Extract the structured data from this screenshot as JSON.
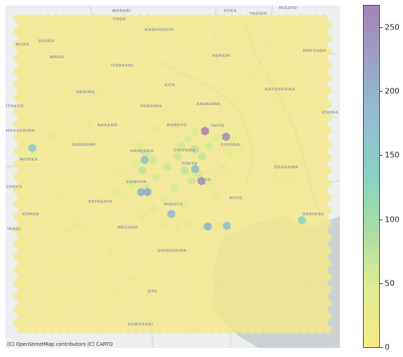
{
  "map": {
    "attribution": "(C) OpenStreetMap contributors (C) CARTO",
    "place_labels": [
      {
        "id": "warabi",
        "text": "WARABI"
      },
      {
        "id": "toda",
        "text": "TODA"
      },
      {
        "id": "soka",
        "text": "SOKA"
      },
      {
        "id": "yashio",
        "text": "YASHIO"
      },
      {
        "id": "misato",
        "text": "MISATO"
      },
      {
        "id": "kawaguchi",
        "text": "KAWAGUCHI"
      },
      {
        "id": "niiza",
        "text": "NIIZA"
      },
      {
        "id": "asaka",
        "text": "ASAKA"
      },
      {
        "id": "wako",
        "text": "WAKO"
      },
      {
        "id": "adachi",
        "text": "ADACHI"
      },
      {
        "id": "matsudo",
        "text": "MATSUDO"
      },
      {
        "id": "itabashi",
        "text": "ITABASHI"
      },
      {
        "id": "kita",
        "text": "KITA"
      },
      {
        "id": "katsushika",
        "text": "KATSUSHIKA"
      },
      {
        "id": "nerima",
        "text": "NERIMA"
      },
      {
        "id": "higashikurume",
        "text": "RTOKYO"
      },
      {
        "id": "toshima",
        "text": "TOSHIMA"
      },
      {
        "id": "arakawa",
        "text": "ARAKAWA"
      },
      {
        "id": "ichikawa",
        "text": "ICHIKA"
      },
      {
        "id": "musashino",
        "text": "MUSASHINO"
      },
      {
        "id": "nakano",
        "text": "NAKANO"
      },
      {
        "id": "bunkyo",
        "text": "BUNKYO"
      },
      {
        "id": "taito",
        "text": "TAITO"
      },
      {
        "id": "suginami",
        "text": "SUGINAMI"
      },
      {
        "id": "sumida",
        "text": "SUMIDA"
      },
      {
        "id": "shinjuku",
        "text": "SHINJUKU"
      },
      {
        "id": "chiyoda",
        "text": "CHIYODA"
      },
      {
        "id": "mitaka",
        "text": "MITAKA"
      },
      {
        "id": "tokyo",
        "text": "TOKYO"
      },
      {
        "id": "edogawa",
        "text": "EDOGAWA"
      },
      {
        "id": "chofu",
        "text": "CHOFU"
      },
      {
        "id": "shibuya",
        "text": "SHIBUYA"
      },
      {
        "id": "chuo",
        "text": "CHUO"
      },
      {
        "id": "setagaya",
        "text": "SETAGAYA"
      },
      {
        "id": "koto",
        "text": "KOTO"
      },
      {
        "id": "urayasu",
        "text": "URAYASU"
      },
      {
        "id": "minato",
        "text": "MINATO"
      },
      {
        "id": "komae",
        "text": "KOMAE"
      },
      {
        "id": "meguro",
        "text": "MEGURO"
      },
      {
        "id": "inagi",
        "text": "INAGI"
      },
      {
        "id": "shinagawa",
        "text": "SHINAGAWA"
      },
      {
        "id": "ota",
        "text": "OTA"
      },
      {
        "id": "kawasaki",
        "text": "KAWASAKI"
      }
    ]
  },
  "colorbar": {
    "ticks": [
      "0",
      "50",
      "100",
      "150",
      "200",
      "250"
    ],
    "tick_values": [
      0,
      50,
      100,
      150,
      200,
      250
    ],
    "max": 267,
    "colors": [
      "#f4ea87",
      "#dfec91",
      "#a6dea3",
      "#88d1c4",
      "#92bccf",
      "#9e9bc6",
      "#a583b6"
    ]
  },
  "hexbin": {
    "color_low": "#f4ea87",
    "color_high": "#a583b6",
    "highlights": [
      {
        "id": "taito-peak",
        "value": 267
      },
      {
        "id": "ueno-peak",
        "value": 240
      },
      {
        "id": "tokyo-station",
        "value": 245
      },
      {
        "id": "shibuya-a",
        "value": 195
      },
      {
        "id": "shibuya-b",
        "value": 205
      },
      {
        "id": "shinjuku-a",
        "value": 150
      },
      {
        "id": "musashino-cell",
        "value": 145
      },
      {
        "id": "minato-cell",
        "value": 180
      },
      {
        "id": "ebisu-cell",
        "value": 190
      },
      {
        "id": "odaiba-cell",
        "value": 155
      },
      {
        "id": "chiyoda-cell",
        "value": 170
      },
      {
        "id": "urayasu-cell",
        "value": 120
      }
    ]
  }
}
